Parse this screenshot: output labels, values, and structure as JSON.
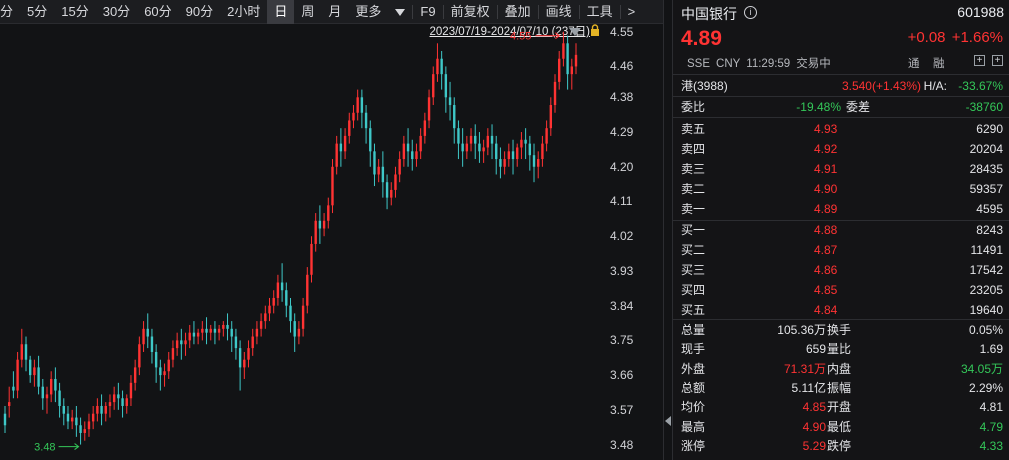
{
  "toolbar": {
    "items": [
      "分",
      "5分",
      "15分",
      "30分",
      "60分",
      "90分",
      "2小时",
      "日",
      "周",
      "月",
      "更多"
    ],
    "active": "日",
    "f9": "F9",
    "items2": [
      "前复权",
      "叠加",
      "画线",
      "工具"
    ],
    "more": ">"
  },
  "range": "2023/07/19-2024/07/10 (237日)",
  "y_axis": [
    "4.55",
    "4.46",
    "4.38",
    "4.29",
    "4.20",
    "4.11",
    "4.02",
    "3.93",
    "3.84",
    "3.75",
    "3.66",
    "3.57",
    "3.48"
  ],
  "annotations": {
    "high": "4.55",
    "low": "3.48"
  },
  "chart_data": {
    "type": "candlestick",
    "ylim": [
      3.44,
      4.57
    ],
    "up_color": "#ff3333",
    "down_color": "#3fc8c8",
    "candles": [
      [
        3.56,
        3.58,
        3.53,
        3.51
      ],
      [
        3.58,
        3.63,
        3.59,
        3.55
      ],
      [
        3.63,
        3.67,
        3.62,
        3.6
      ],
      [
        3.62,
        3.72,
        3.7,
        3.6
      ],
      [
        3.7,
        3.78,
        3.74,
        3.68
      ],
      [
        3.74,
        3.76,
        3.7,
        3.67
      ],
      [
        3.7,
        3.71,
        3.66,
        3.64
      ],
      [
        3.66,
        3.7,
        3.68,
        3.63
      ],
      [
        3.68,
        3.71,
        3.63,
        3.61
      ],
      [
        3.63,
        3.65,
        3.6,
        3.57
      ],
      [
        3.6,
        3.63,
        3.61,
        3.56
      ],
      [
        3.61,
        3.67,
        3.65,
        3.59
      ],
      [
        3.65,
        3.68,
        3.62,
        3.59
      ],
      [
        3.62,
        3.64,
        3.58,
        3.55
      ],
      [
        3.58,
        3.6,
        3.56,
        3.53
      ],
      [
        3.56,
        3.58,
        3.54,
        3.52
      ],
      [
        3.54,
        3.57,
        3.55,
        3.52
      ],
      [
        3.55,
        3.58,
        3.53,
        3.5
      ],
      [
        3.53,
        3.55,
        3.51,
        3.48
      ],
      [
        3.51,
        3.54,
        3.52,
        3.49
      ],
      [
        3.52,
        3.56,
        3.54,
        3.5
      ],
      [
        3.54,
        3.58,
        3.56,
        3.52
      ],
      [
        3.56,
        3.6,
        3.58,
        3.54
      ],
      [
        3.58,
        3.61,
        3.56,
        3.53
      ],
      [
        3.56,
        3.59,
        3.58,
        3.54
      ],
      [
        3.58,
        3.61,
        3.59,
        3.55
      ],
      [
        3.59,
        3.63,
        3.61,
        3.57
      ],
      [
        3.61,
        3.64,
        3.6,
        3.57
      ],
      [
        3.6,
        3.62,
        3.58,
        3.55
      ],
      [
        3.58,
        3.61,
        3.6,
        3.56
      ],
      [
        3.6,
        3.66,
        3.64,
        3.58
      ],
      [
        3.64,
        3.7,
        3.68,
        3.62
      ],
      [
        3.68,
        3.76,
        3.74,
        3.66
      ],
      [
        3.74,
        3.8,
        3.78,
        3.72
      ],
      [
        3.78,
        3.82,
        3.76,
        3.73
      ],
      [
        3.76,
        3.78,
        3.72,
        3.69
      ],
      [
        3.72,
        3.74,
        3.68,
        3.64
      ],
      [
        3.68,
        3.7,
        3.66,
        3.62
      ],
      [
        3.66,
        3.69,
        3.67,
        3.63
      ],
      [
        3.67,
        3.72,
        3.7,
        3.65
      ],
      [
        3.7,
        3.75,
        3.73,
        3.68
      ],
      [
        3.73,
        3.77,
        3.75,
        3.71
      ],
      [
        3.75,
        3.78,
        3.74,
        3.7
      ],
      [
        3.74,
        3.77,
        3.75,
        3.71
      ],
      [
        3.75,
        3.79,
        3.77,
        3.73
      ],
      [
        3.77,
        3.8,
        3.76,
        3.74
      ],
      [
        3.76,
        3.78,
        3.77,
        3.74
      ],
      [
        3.77,
        3.8,
        3.78,
        3.75
      ],
      [
        3.78,
        3.81,
        3.77,
        3.74
      ],
      [
        3.77,
        3.79,
        3.78,
        3.75
      ],
      [
        3.78,
        3.8,
        3.77,
        3.74
      ],
      [
        3.77,
        3.79,
        3.78,
        3.75
      ],
      [
        3.78,
        3.8,
        3.79,
        3.76
      ],
      [
        3.79,
        3.82,
        3.78,
        3.75
      ],
      [
        3.78,
        3.8,
        3.76,
        3.72
      ],
      [
        3.76,
        3.78,
        3.73,
        3.7
      ],
      [
        3.73,
        3.75,
        3.68,
        3.62
      ],
      [
        3.68,
        3.72,
        3.7,
        3.65
      ],
      [
        3.7,
        3.75,
        3.73,
        3.68
      ],
      [
        3.73,
        3.78,
        3.76,
        3.71
      ],
      [
        3.76,
        3.8,
        3.78,
        3.74
      ],
      [
        3.78,
        3.82,
        3.8,
        3.76
      ],
      [
        3.8,
        3.84,
        3.82,
        3.78
      ],
      [
        3.82,
        3.86,
        3.84,
        3.8
      ],
      [
        3.84,
        3.88,
        3.86,
        3.82
      ],
      [
        3.86,
        3.92,
        3.9,
        3.84
      ],
      [
        3.9,
        3.95,
        3.88,
        3.85
      ],
      [
        3.88,
        3.9,
        3.84,
        3.81
      ],
      [
        3.84,
        3.86,
        3.8,
        3.77
      ],
      [
        3.8,
        3.82,
        3.76,
        3.72
      ],
      [
        3.76,
        3.8,
        3.78,
        3.74
      ],
      [
        3.78,
        3.86,
        3.84,
        3.76
      ],
      [
        3.84,
        3.94,
        3.92,
        3.82
      ],
      [
        3.92,
        4.02,
        4.0,
        3.9
      ],
      [
        4.0,
        4.08,
        4.06,
        3.98
      ],
      [
        4.06,
        4.1,
        4.04,
        4.0
      ],
      [
        4.04,
        4.08,
        4.06,
        4.02
      ],
      [
        4.06,
        4.12,
        4.1,
        4.04
      ],
      [
        4.1,
        4.22,
        4.2,
        4.08
      ],
      [
        4.2,
        4.28,
        4.26,
        4.18
      ],
      [
        4.26,
        4.3,
        4.24,
        4.2
      ],
      [
        4.24,
        4.3,
        4.28,
        4.22
      ],
      [
        4.28,
        4.34,
        4.32,
        4.26
      ],
      [
        4.32,
        4.36,
        4.34,
        4.3
      ],
      [
        4.34,
        4.4,
        4.38,
        4.32
      ],
      [
        4.38,
        4.4,
        4.34,
        4.3
      ],
      [
        4.34,
        4.36,
        4.3,
        4.26
      ],
      [
        4.3,
        4.32,
        4.24,
        4.2
      ],
      [
        4.24,
        4.26,
        4.18,
        4.15
      ],
      [
        4.18,
        4.22,
        4.2,
        4.16
      ],
      [
        4.2,
        4.24,
        4.16,
        4.12
      ],
      [
        4.16,
        4.18,
        4.12,
        4.09
      ],
      [
        4.12,
        4.16,
        4.14,
        4.1
      ],
      [
        4.14,
        4.2,
        4.18,
        4.12
      ],
      [
        4.18,
        4.24,
        4.22,
        4.16
      ],
      [
        4.22,
        4.28,
        4.26,
        4.2
      ],
      [
        4.26,
        4.3,
        4.24,
        4.2
      ],
      [
        4.24,
        4.27,
        4.22,
        4.19
      ],
      [
        4.22,
        4.26,
        4.24,
        4.2
      ],
      [
        4.24,
        4.3,
        4.28,
        4.22
      ],
      [
        4.28,
        4.34,
        4.32,
        4.26
      ],
      [
        4.32,
        4.4,
        4.38,
        4.3
      ],
      [
        4.38,
        4.46,
        4.44,
        4.36
      ],
      [
        4.44,
        4.52,
        4.48,
        4.42
      ],
      [
        4.48,
        4.5,
        4.44,
        4.4
      ],
      [
        4.44,
        4.46,
        4.38,
        4.34
      ],
      [
        4.38,
        4.42,
        4.36,
        4.32
      ],
      [
        4.36,
        4.38,
        4.3,
        4.26
      ],
      [
        4.3,
        4.32,
        4.26,
        4.22
      ],
      [
        4.26,
        4.3,
        4.24,
        4.2
      ],
      [
        4.24,
        4.28,
        4.26,
        4.22
      ],
      [
        4.26,
        4.3,
        4.28,
        4.24
      ],
      [
        4.28,
        4.31,
        4.26,
        4.22
      ],
      [
        4.26,
        4.29,
        4.24,
        4.21
      ],
      [
        4.24,
        4.27,
        4.25,
        4.21
      ],
      [
        4.25,
        4.3,
        4.28,
        4.23
      ],
      [
        4.28,
        4.31,
        4.26,
        4.22
      ],
      [
        4.26,
        4.28,
        4.22,
        4.18
      ],
      [
        4.22,
        4.25,
        4.2,
        4.17
      ],
      [
        4.2,
        4.24,
        4.22,
        4.18
      ],
      [
        4.22,
        4.26,
        4.24,
        4.2
      ],
      [
        4.24,
        4.27,
        4.22,
        4.18
      ],
      [
        4.22,
        4.26,
        4.25,
        4.2
      ],
      [
        4.25,
        4.29,
        4.27,
        4.22
      ],
      [
        4.27,
        4.3,
        4.26,
        4.22
      ],
      [
        4.26,
        4.28,
        4.23,
        4.19
      ],
      [
        4.23,
        4.26,
        4.2,
        4.16
      ],
      [
        4.2,
        4.24,
        4.22,
        4.17
      ],
      [
        4.22,
        4.28,
        4.26,
        4.2
      ],
      [
        4.26,
        4.32,
        4.3,
        4.24
      ],
      [
        4.3,
        4.38,
        4.36,
        4.28
      ],
      [
        4.36,
        4.44,
        4.42,
        4.34
      ],
      [
        4.42,
        4.5,
        4.48,
        4.4
      ],
      [
        4.48,
        4.55,
        4.52,
        4.46
      ],
      [
        4.52,
        4.54,
        4.44,
        4.4
      ],
      [
        4.44,
        4.48,
        4.46,
        4.4
      ],
      [
        4.46,
        4.52,
        4.49,
        4.44
      ]
    ]
  },
  "quote": {
    "name": "中国银行",
    "info_icon": "i",
    "code": "601988",
    "price": "4.89",
    "change": "+0.08",
    "pct": "+1.66%",
    "exch": "SSE",
    "cur": "CNY",
    "time": "11:29:59",
    "status": "交易中",
    "tag1": "通",
    "tag2": "融",
    "plus": "+"
  },
  "hk": {
    "label": "港(3988)",
    "value": "3.540(+1.43%)",
    "ha_label": "H/A:",
    "ha_value": "-33.67%"
  },
  "committee": {
    "label1": "委比",
    "value1": "-19.48%",
    "label2": "委差",
    "value2": "-38760"
  },
  "asks": [
    {
      "label": "卖五",
      "price": "4.93",
      "vol": "6290"
    },
    {
      "label": "卖四",
      "price": "4.92",
      "vol": "20204"
    },
    {
      "label": "卖三",
      "price": "4.91",
      "vol": "28435"
    },
    {
      "label": "卖二",
      "price": "4.90",
      "vol": "59357"
    },
    {
      "label": "卖一",
      "price": "4.89",
      "vol": "4595"
    }
  ],
  "bids": [
    {
      "label": "买一",
      "price": "4.88",
      "vol": "8243"
    },
    {
      "label": "买二",
      "price": "4.87",
      "vol": "11491"
    },
    {
      "label": "买三",
      "price": "4.86",
      "vol": "17542"
    },
    {
      "label": "买四",
      "price": "4.85",
      "vol": "23205"
    },
    {
      "label": "买五",
      "price": "4.84",
      "vol": "19640"
    }
  ],
  "stats": [
    {
      "l1": "总量",
      "v1": "105.36万",
      "l2": "换手",
      "v2": "0.05%",
      "c1": "wht",
      "c2": "wht"
    },
    {
      "l1": "现手",
      "v1": "659",
      "l2": "量比",
      "v2": "1.69",
      "c1": "wht",
      "c2": "wht"
    },
    {
      "l1": "外盘",
      "v1": "71.31万",
      "l2": "内盘",
      "v2": "34.05万",
      "c1": "red",
      "c2": "green"
    },
    {
      "l1": "总额",
      "v1": "5.11亿",
      "l2": "振幅",
      "v2": "2.29%",
      "c1": "wht",
      "c2": "wht"
    },
    {
      "l1": "均价",
      "v1": "4.85",
      "l2": "开盘",
      "v2": "4.81",
      "c1": "red",
      "c2": "wht"
    },
    {
      "l1": "最高",
      "v1": "4.90",
      "l2": "最低",
      "v2": "4.79",
      "c1": "red",
      "c2": "green"
    },
    {
      "l1": "涨停",
      "v1": "5.29",
      "l2": "跌停",
      "v2": "4.33",
      "c1": "red",
      "c2": "green"
    }
  ]
}
